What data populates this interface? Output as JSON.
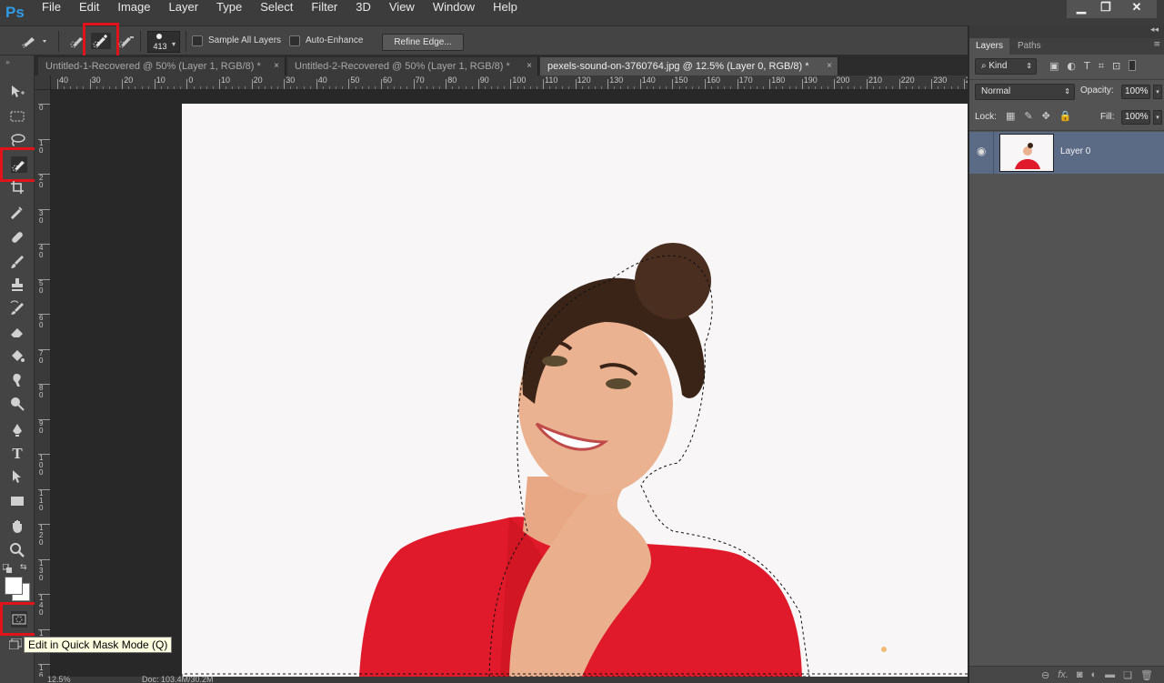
{
  "app": {
    "logo": "Ps"
  },
  "menu": [
    "File",
    "Edit",
    "Image",
    "Layer",
    "Type",
    "Select",
    "Filter",
    "3D",
    "View",
    "Window",
    "Help"
  ],
  "window_controls": {
    "minimize": "▁",
    "restore": "❐",
    "close": "✕"
  },
  "options": {
    "brush_size": "413",
    "sample_all_layers": "Sample All Layers",
    "auto_enhance": "Auto-Enhance",
    "refine_edge": "Refine Edge..."
  },
  "tabs": [
    {
      "title": "Untitled-1-Recovered @ 50% (Layer 1, RGB/8) *",
      "close": "×"
    },
    {
      "title": "Untitled-2-Recovered @ 50% (Layer 1, RGB/8) *",
      "close": "×"
    },
    {
      "title": "pexels-sound-on-3760764.jpg @ 12.5% (Layer 0, RGB/8) *",
      "close": "×"
    }
  ],
  "ruler": {
    "h": [
      "40",
      "30",
      "20",
      "10",
      "0",
      "10",
      "20",
      "30",
      "40",
      "50",
      "60",
      "70",
      "80",
      "90",
      "100",
      "110",
      "120",
      "130",
      "140",
      "150",
      "160",
      "170",
      "180",
      "190",
      "200",
      "210",
      "220",
      "230",
      "24"
    ],
    "v": [
      "0",
      "1\n0",
      "2\n0",
      "3\n0",
      "4\n0",
      "5\n0",
      "6\n0",
      "7\n0",
      "8\n0",
      "9\n0",
      "1\n0\n0",
      "1\n1\n0",
      "1\n2\n0",
      "1\n3\n0",
      "1\n4\n0",
      "1\n5\n0",
      "1\n6\n0"
    ]
  },
  "tooltip": "Edit in Quick Mask Mode (Q)",
  "status": {
    "zoom": "12.5%",
    "doc": "Doc: 103.4M/30.2M"
  },
  "layers_panel": {
    "tabs": [
      "Layers",
      "Paths"
    ],
    "filter_kind": "Kind",
    "blend_mode": "Normal",
    "opacity_label": "Opacity:",
    "opacity_value": "100%",
    "lock_label": "Lock:",
    "fill_label": "Fill:",
    "fill_value": "100%",
    "layers": [
      {
        "name": "Layer 0",
        "visible": true
      }
    ],
    "footer_icons": [
      "link-icon",
      "fx-icon",
      "mask-icon",
      "adjustment-icon",
      "folder-icon",
      "new-layer-icon",
      "trash-icon"
    ]
  },
  "colors": {
    "selection_highlight": "#e0131b",
    "layer_selected": "#5b6b86",
    "ps_blue": "#2f9be6",
    "sweater_red": "#e01a2a"
  }
}
